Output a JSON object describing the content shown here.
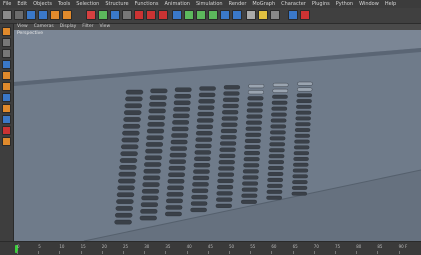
{
  "menu": [
    "File",
    "Edit",
    "Objects",
    "Tools",
    "Selection",
    "Structure",
    "Functions",
    "Animation",
    "Simulation",
    "Render",
    "MoGraph",
    "Character",
    "Plugins",
    "Python",
    "Window",
    "Help"
  ],
  "viewport_menu": [
    "View",
    "Cameras",
    "Display",
    "Filter",
    "View"
  ],
  "viewport_label": "Perspective",
  "timeline": {
    "ticks": [
      "0",
      "5",
      "10",
      "15",
      "20",
      "25",
      "30",
      "35",
      "40",
      "45",
      "50",
      "55",
      "60",
      "65",
      "70",
      "75",
      "80",
      "85",
      "90 F"
    ],
    "current_frame": 0
  },
  "colors": {
    "accent_orange": "#e08a2c",
    "accent_blue": "#3a78c8",
    "timeline_marker": "#3ad13a"
  },
  "icons": {
    "toolbar": [
      "undo-icon",
      "cursor-icon",
      "move-icon",
      "scale-icon",
      "rotate-icon",
      "live-selection-icon",
      "x-axis-icon",
      "y-axis-icon",
      "z-axis-icon",
      "world-coordinates-icon",
      "render-region-icon",
      "render-view-icon",
      "render-settings-icon",
      "cube-icon",
      "spline-icon",
      "nurbs-icon",
      "array-icon",
      "deformer-icon",
      "scene-icon",
      "camera-icon",
      "light-icon",
      "texture-icon",
      "move-tool-icon",
      "snap-icon"
    ],
    "left": [
      "model-mode-icon",
      "texture-mode-icon",
      "workplane-icon",
      "points-mode-icon",
      "edges-mode-icon",
      "polygons-mode-icon",
      "axis-mode-icon",
      "tweak-icon",
      "soft-selection-icon",
      "snapping-icon",
      "lock-icon"
    ]
  }
}
